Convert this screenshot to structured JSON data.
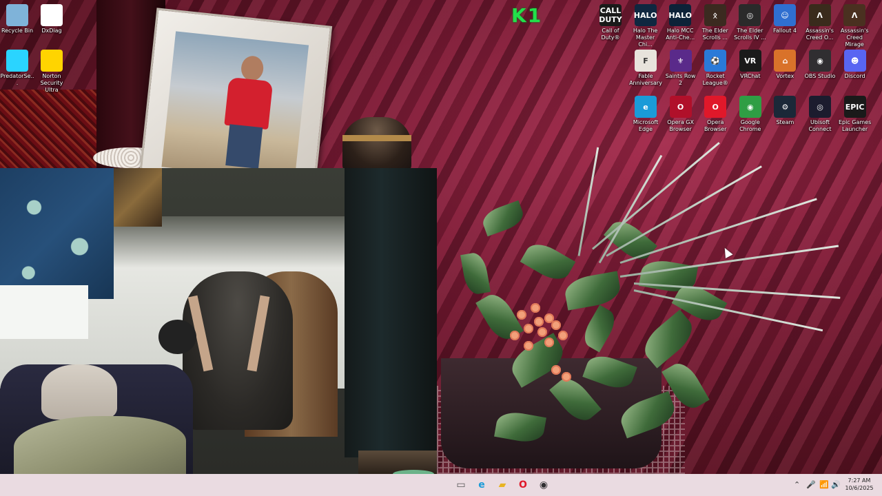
{
  "brand": {
    "overlay_text": "K1",
    "overlay_color": "#22e04a"
  },
  "desktop_icons_left": [
    {
      "label": "Recycle Bin",
      "icon": "recycle-bin-icon",
      "color": "#7fb3d9"
    },
    {
      "label": "DxDiag",
      "icon": "document-icon",
      "color": "#ffffff"
    },
    {
      "label": "PredatorSe...",
      "icon": "predator-sense-icon",
      "color": "#2ad4ff"
    },
    {
      "label": "Norton Security Ultra",
      "icon": "norton-icon",
      "color": "#ffd400"
    }
  ],
  "desktop_icons_right_row1": [
    {
      "label": "Call of Duty®",
      "icon": "call-of-duty-icon",
      "glyph": "CALL\nDUTY",
      "color": "#1a1a1a"
    },
    {
      "label": "Halo The Master Chi...",
      "icon": "halo-icon",
      "glyph": "HALO",
      "color": "#0f2740"
    },
    {
      "label": "Halo MCC Anti-Che...",
      "icon": "halo-mcc-icon",
      "glyph": "HALO",
      "color": "#0d2238"
    },
    {
      "label": "The Elder Scrolls ...",
      "icon": "elder-scrolls-icon",
      "glyph": "ᛟ",
      "color": "#3b2a20"
    },
    {
      "label": "The Elder Scrolls IV ...",
      "icon": "oblivion-icon",
      "glyph": "◎",
      "color": "#2a2a2a"
    },
    {
      "label": "Fallout 4",
      "icon": "fallout-icon",
      "glyph": "☺",
      "color": "#2f6fd0"
    },
    {
      "label": "Assassin's Creed O...",
      "icon": "assassins-creed-odyssey-icon",
      "glyph": "Λ",
      "color": "#3a2b1c"
    },
    {
      "label": "Assassin's Creed Mirage",
      "icon": "assassins-creed-mirage-icon",
      "glyph": "Λ",
      "color": "#4a3020"
    }
  ],
  "desktop_icons_right_row2": [
    {
      "label": "Fable Anniversary",
      "icon": "fable-icon",
      "glyph": "F",
      "color": "#e8e3dc"
    },
    {
      "label": "Saints Row 2",
      "icon": "saints-row-icon",
      "glyph": "⚜",
      "color": "#5a2a8a"
    },
    {
      "label": "Rocket League®",
      "icon": "rocket-league-icon",
      "glyph": "⚽",
      "color": "#2a7ad8"
    },
    {
      "label": "VRChat",
      "icon": "vrchat-icon",
      "glyph": "VR",
      "color": "#1a1a1a"
    },
    {
      "label": "Vortex",
      "icon": "vortex-icon",
      "glyph": "⌂",
      "color": "#d9722a"
    },
    {
      "label": "OBS Studio",
      "icon": "obs-icon",
      "glyph": "◉",
      "color": "#302e31"
    },
    {
      "label": "Discord",
      "icon": "discord-icon",
      "glyph": "☻",
      "color": "#5865f2"
    }
  ],
  "desktop_icons_right_row3": [
    {
      "label": "Microsoft Edge",
      "icon": "edge-icon",
      "glyph": "e",
      "color": "#1a9bd8"
    },
    {
      "label": "Opera GX Browser",
      "icon": "opera-gx-icon",
      "glyph": "O",
      "color": "#b0102a"
    },
    {
      "label": "Opera Browser",
      "icon": "opera-icon",
      "glyph": "O",
      "color": "#e0182a"
    },
    {
      "label": "Google Chrome",
      "icon": "chrome-icon",
      "glyph": "◉",
      "color": "#2f9e44"
    },
    {
      "label": "Steam",
      "icon": "steam-icon",
      "glyph": "⚙",
      "color": "#1b2838"
    },
    {
      "label": "Ubisoft Connect",
      "icon": "ubisoft-icon",
      "glyph": "◎",
      "color": "#1c1c2e"
    },
    {
      "label": "Epic Games Launcher",
      "icon": "epic-games-icon",
      "glyph": "EPIC",
      "color": "#1a1a1a"
    }
  ],
  "taskbar": {
    "apps": [
      {
        "icon": "task-view-icon",
        "glyph": "▭",
        "color": "#555555"
      },
      {
        "icon": "edge-icon",
        "glyph": "e",
        "color": "#1a9bd8"
      },
      {
        "icon": "file-explorer-icon",
        "glyph": "▰",
        "color": "#e8b422"
      },
      {
        "icon": "opera-icon",
        "glyph": "O",
        "color": "#e0182a"
      },
      {
        "icon": "obs-icon",
        "glyph": "◉",
        "color": "#302e31"
      }
    ],
    "tray": {
      "chevron": "⌃",
      "mic": "🎤",
      "wifi": "📶",
      "speaker": "🔊",
      "time": "7:27 AM",
      "date": "10/6/2025"
    }
  }
}
